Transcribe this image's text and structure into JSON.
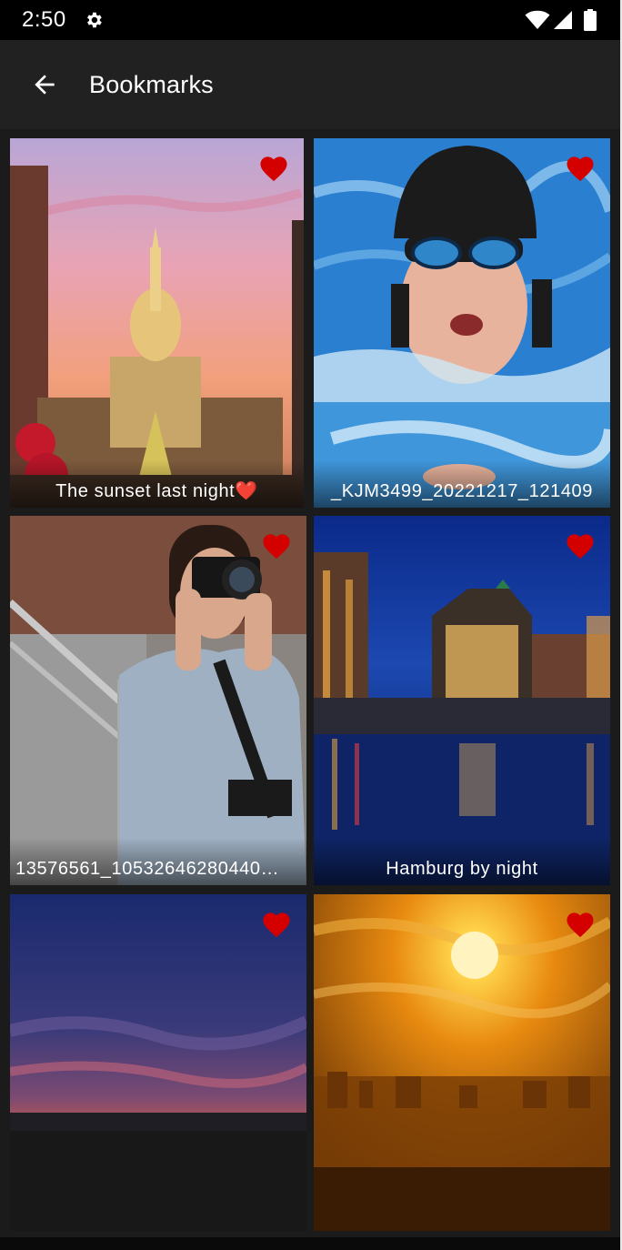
{
  "status_bar": {
    "time": "2:50",
    "icons": [
      "gear-icon",
      "wifi-icon",
      "signal-icon",
      "battery-icon"
    ]
  },
  "app_bar": {
    "back_icon": "arrow-left-icon",
    "title": "Bookmarks"
  },
  "colors": {
    "status_bar": "#000000",
    "app_bar": "#212121",
    "background": "#1b1b1b",
    "heart": "#d40000",
    "text": "#ffffff"
  },
  "bookmarks": [
    {
      "caption": "The sunset last night❤️",
      "bookmarked": true,
      "scene": "capitol building at sunset"
    },
    {
      "caption": "_KJM3499_20221217_121409",
      "bookmarked": true,
      "scene": "swimmer with goggles"
    },
    {
      "caption": "13576561_10532646280440…",
      "bookmarked": true,
      "scene": "woman with camera"
    },
    {
      "caption": "Hamburg by night",
      "bookmarked": true,
      "scene": "city waterfront at night"
    },
    {
      "caption": "",
      "bookmarked": true,
      "scene": "dusk sky over field"
    },
    {
      "caption": "",
      "bookmarked": true,
      "scene": "orange sun over skyline"
    }
  ]
}
